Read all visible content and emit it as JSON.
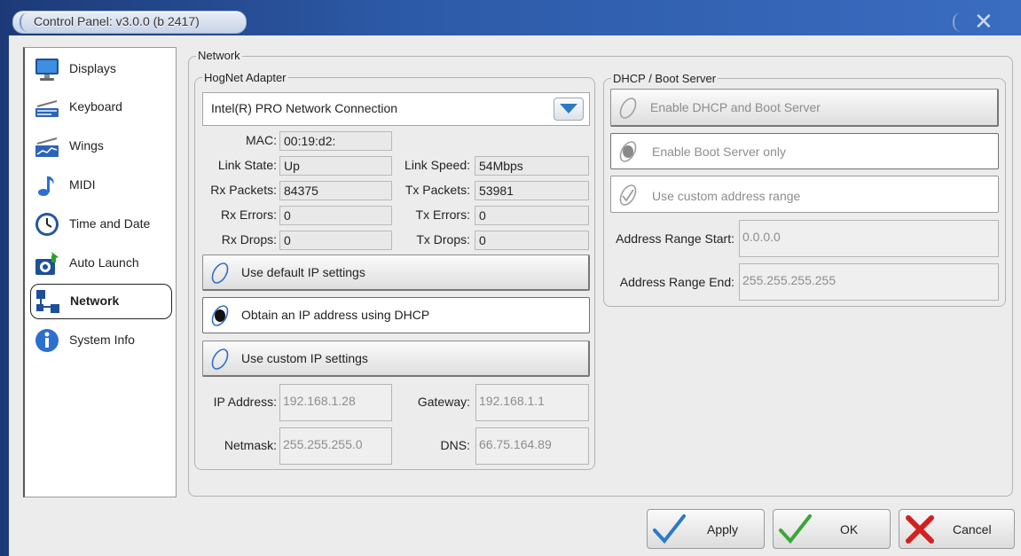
{
  "window": {
    "title": "Control Panel: v3.0.0 (b 2417)"
  },
  "sidebar": {
    "items": [
      {
        "label": "Displays",
        "icon": "monitor-icon"
      },
      {
        "label": "Keyboard",
        "icon": "keyboard-icon"
      },
      {
        "label": "Wings",
        "icon": "wing-console-icon"
      },
      {
        "label": "MIDI",
        "icon": "music-note-icon"
      },
      {
        "label": "Time and Date",
        "icon": "clock-icon"
      },
      {
        "label": "Auto Launch",
        "icon": "auto-launch-icon"
      },
      {
        "label": "Network",
        "icon": "network-icon",
        "selected": true
      },
      {
        "label": "System Info",
        "icon": "info-icon"
      }
    ]
  },
  "network": {
    "group_label": "Network",
    "adapter": {
      "group_label": "HogNet Adapter",
      "selected_adapter": "Intel(R) PRO  Network Connection",
      "mac_label": "MAC:",
      "mac_value": "00:19:d2:",
      "link_state_label": "Link State:",
      "link_state_value": "Up",
      "link_speed_label": "Link Speed:",
      "link_speed_value": "54Mbps",
      "rx_packets_label": "Rx Packets:",
      "rx_packets_value": "84375",
      "tx_packets_label": "Tx Packets:",
      "tx_packets_value": "53981",
      "rx_errors_label": "Rx Errors:",
      "rx_errors_value": "0",
      "tx_errors_label": "Tx Errors:",
      "tx_errors_value": "0",
      "rx_drops_label": "Rx Drops:",
      "rx_drops_value": "0",
      "tx_drops_label": "Tx Drops:",
      "tx_drops_value": "0",
      "options": {
        "default_ip": "Use default IP settings",
        "dhcp": "Obtain an IP address using DHCP",
        "custom_ip": "Use custom IP settings",
        "selected": "dhcp"
      },
      "ip_address_label": "IP Address:",
      "ip_address_value": "192.168.1.28",
      "gateway_label": "Gateway:",
      "gateway_value": "192.168.1.1",
      "netmask_label": "Netmask:",
      "netmask_value": "255.255.255.0",
      "dns_label": "DNS:",
      "dns_value": "66.75.164.89"
    },
    "dhcp_server": {
      "group_label": "DHCP / Boot Server",
      "enable_dhcp_boot": "Enable DHCP and Boot Server",
      "enable_boot_only": "Enable Boot Server only",
      "custom_range": "Use custom address range",
      "selected": "enable_boot_only",
      "range_start_label": "Address Range Start:",
      "range_start_value": "0.0.0.0",
      "range_end_label": "Address Range End:",
      "range_end_value": "255.255.255.255"
    }
  },
  "footer": {
    "apply_label": "Apply",
    "ok_label": "OK",
    "cancel_label": "Cancel"
  },
  "colors": {
    "title_bar": "#2d5aa8",
    "accent_blue": "#2b7ac6",
    "ok_green": "#3aa63a",
    "cancel_red": "#d32020"
  }
}
